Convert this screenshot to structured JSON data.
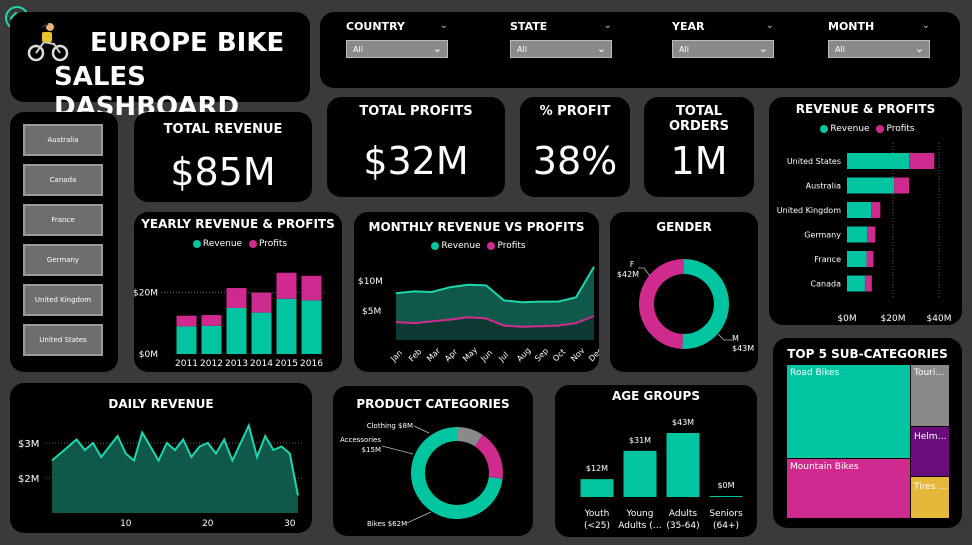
{
  "back_button": {
    "icon": "back-arrow-icon"
  },
  "logo": {
    "icon": "cyclist-icon"
  },
  "header": {
    "title_line1": "EUROPE BIKE",
    "title_line2": "SALES DASHBOARD"
  },
  "filters": [
    {
      "label": "COUNTRY",
      "value": "All"
    },
    {
      "label": "STATE",
      "value": "All"
    },
    {
      "label": "YEAR",
      "value": "All"
    },
    {
      "label": "MONTH",
      "value": "All"
    }
  ],
  "country_slicer": [
    "Australia",
    "Canada",
    "France",
    "Germany",
    "United Kingdom",
    "United States"
  ],
  "kpis": {
    "total_revenue": {
      "label": "TOTAL REVENUE",
      "value": "$85M"
    },
    "total_profits": {
      "label": "TOTAL PROFITS",
      "value": "$32M"
    },
    "pct_profit": {
      "label": "% PROFIT",
      "value": "38%"
    },
    "total_orders": {
      "label": "TOTAL ORDERS",
      "value": "1M"
    }
  },
  "legend": {
    "revenue": "Revenue",
    "profits": "Profits"
  },
  "colors": {
    "revenue": "#01c4a0",
    "profits": "#cf2b8e",
    "area_fill": "#10594a",
    "area_line": "#1fd6ad",
    "grey": "#8a8a8a",
    "purple": "#6a0c7c",
    "yellow": "#e6b83a",
    "dark_grey": "#555555"
  },
  "chart_data": [
    {
      "id": "yearly",
      "type": "bar",
      "title": "YEARLY REVENUE & PROFITS",
      "categories": [
        "2011",
        "2012",
        "2013",
        "2014",
        "2015",
        "2016"
      ],
      "series": [
        {
          "name": "Revenue",
          "values": [
            9,
            9.2,
            15,
            13.5,
            18,
            17.5
          ]
        },
        {
          "name": "Profits",
          "values": [
            3.5,
            3.5,
            6.5,
            6.5,
            8.5,
            8
          ]
        }
      ],
      "stacked": true,
      "yticks": [
        "$0M",
        "$20M"
      ],
      "ylim": [
        0,
        30
      ]
    },
    {
      "id": "monthly",
      "type": "area",
      "title": "MONTHLY REVENUE VS PROFITS",
      "categories": [
        "Jan",
        "Feb",
        "Mar",
        "Apr",
        "May",
        "Jun",
        "Jul",
        "Aug",
        "Sep",
        "Oct",
        "Nov",
        "Dec"
      ],
      "series": [
        {
          "name": "Revenue",
          "values": [
            7.8,
            8.1,
            8,
            8.8,
            9.2,
            9.1,
            6.6,
            6.3,
            6.4,
            6.4,
            7.1,
            12.2
          ]
        },
        {
          "name": "Profits",
          "values": [
            3,
            2.8,
            3.1,
            3.4,
            3.8,
            3.6,
            2.4,
            2.2,
            2.3,
            2.4,
            2.8,
            4
          ]
        }
      ],
      "yticks": [
        "$10M",
        "$5M"
      ],
      "ylim": [
        0,
        14
      ]
    },
    {
      "id": "gender",
      "type": "pie",
      "title": "GENDER",
      "labels": [
        "F",
        "M"
      ],
      "values": [
        42,
        43
      ],
      "value_labels": [
        "$42M",
        "$43M"
      ]
    },
    {
      "id": "country",
      "type": "bar",
      "orientation": "horizontal",
      "title": "REVENUE & PROFITS",
      "categories": [
        "United States",
        "Australia",
        "United Kingdom",
        "Germany",
        "France",
        "Canada"
      ],
      "series": [
        {
          "name": "Revenue",
          "values": [
            27,
            20.5,
            10.5,
            8.8,
            8.5,
            7.8
          ]
        },
        {
          "name": "Profits",
          "values": [
            11,
            6.5,
            4,
            3.5,
            3,
            3
          ]
        }
      ],
      "stacked": true,
      "xticks": [
        "$0M",
        "$20M",
        "$40M"
      ],
      "xlim": [
        0,
        40
      ]
    },
    {
      "id": "daily",
      "type": "area",
      "title": "DAILY REVENUE",
      "x": [
        1,
        2,
        3,
        4,
        5,
        6,
        7,
        8,
        9,
        10,
        11,
        12,
        13,
        14,
        15,
        16,
        17,
        18,
        19,
        20,
        21,
        22,
        23,
        24,
        25,
        26,
        27,
        28,
        29,
        30,
        31
      ],
      "values": [
        2.5,
        2.7,
        2.9,
        3.1,
        2.8,
        3.0,
        2.6,
        2.9,
        3.2,
        2.7,
        2.5,
        3.3,
        2.9,
        2.5,
        3.0,
        2.8,
        3.1,
        2.6,
        2.9,
        3.0,
        2.7,
        3.1,
        2.5,
        3.0,
        3.5,
        2.6,
        3.2,
        2.8,
        2.9,
        2.7,
        1.5
      ],
      "xticks": [
        "10",
        "20",
        "30"
      ],
      "yticks": [
        "$3M",
        "$2M"
      ],
      "ylim": [
        1,
        3.8
      ]
    },
    {
      "id": "product",
      "type": "pie",
      "title": "PRODUCT CATEGORIES",
      "labels": [
        "Clothing",
        "Accessories",
        "Bikes"
      ],
      "values": [
        8,
        15,
        62
      ],
      "value_labels": [
        "Clothing $8M",
        "Accessories $15M",
        "Bikes $62M"
      ]
    },
    {
      "id": "age",
      "type": "bar",
      "title": "AGE GROUPS",
      "categories": [
        "Youth (<25)",
        "Young Adults (…",
        "Adults (35-64)",
        "Seniors (64+)"
      ],
      "values": [
        12,
        31,
        43,
        0.3
      ],
      "value_labels": [
        "$12M",
        "$31M",
        "$43M",
        "$0M"
      ]
    },
    {
      "id": "subcat",
      "type": "treemap",
      "title": "TOP 5 SUB-CATEGORIES",
      "labels": [
        "Road Bikes",
        "Mountain Bikes",
        "Touri…",
        "Helm…",
        "Tires …"
      ]
    }
  ]
}
